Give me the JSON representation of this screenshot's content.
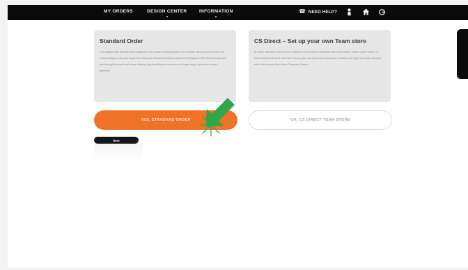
{
  "nav": {
    "items": [
      {
        "label": "MY ORDERS"
      },
      {
        "label": "DESIGN CENTER"
      },
      {
        "label": "INFORMATION"
      }
    ],
    "help_label": "NEED HELP?"
  },
  "cards": {
    "standard": {
      "title": "Standard Order",
      "text": "Our original order process that changed the way custom clothing worked. We will work with you to co-create your custom designs, pick your styles then order your kit with a minimum of just 10 multi pieces. We then hit design and print through to small local teams offering huge flexibility and access to our huge range of premium custom garments."
    },
    "cs_direct": {
      "title": "CS Direct – Set up your own Team store",
      "text": "An order collection for entire your collection for moving the distribution the store brands. Ensure good? NWO CS Direct delivers all of the work here. Set up your own team store where your members can log in and order securely within New Impact direct from Champion System."
    }
  },
  "buttons": {
    "standard": "YES, STANDARD ORDER",
    "team_store": "OK, CS DIRECT TEAM STORE",
    "back": "Back"
  },
  "colors": {
    "topbar": "#0b0b0b",
    "accent_orange": "#ef7227",
    "pointer_green": "#2fa84a"
  },
  "icons": [
    "phone-icon",
    "user-icon",
    "home-icon",
    "logout-icon",
    "arrow-pointer-icon",
    "click-burst-icon"
  ]
}
